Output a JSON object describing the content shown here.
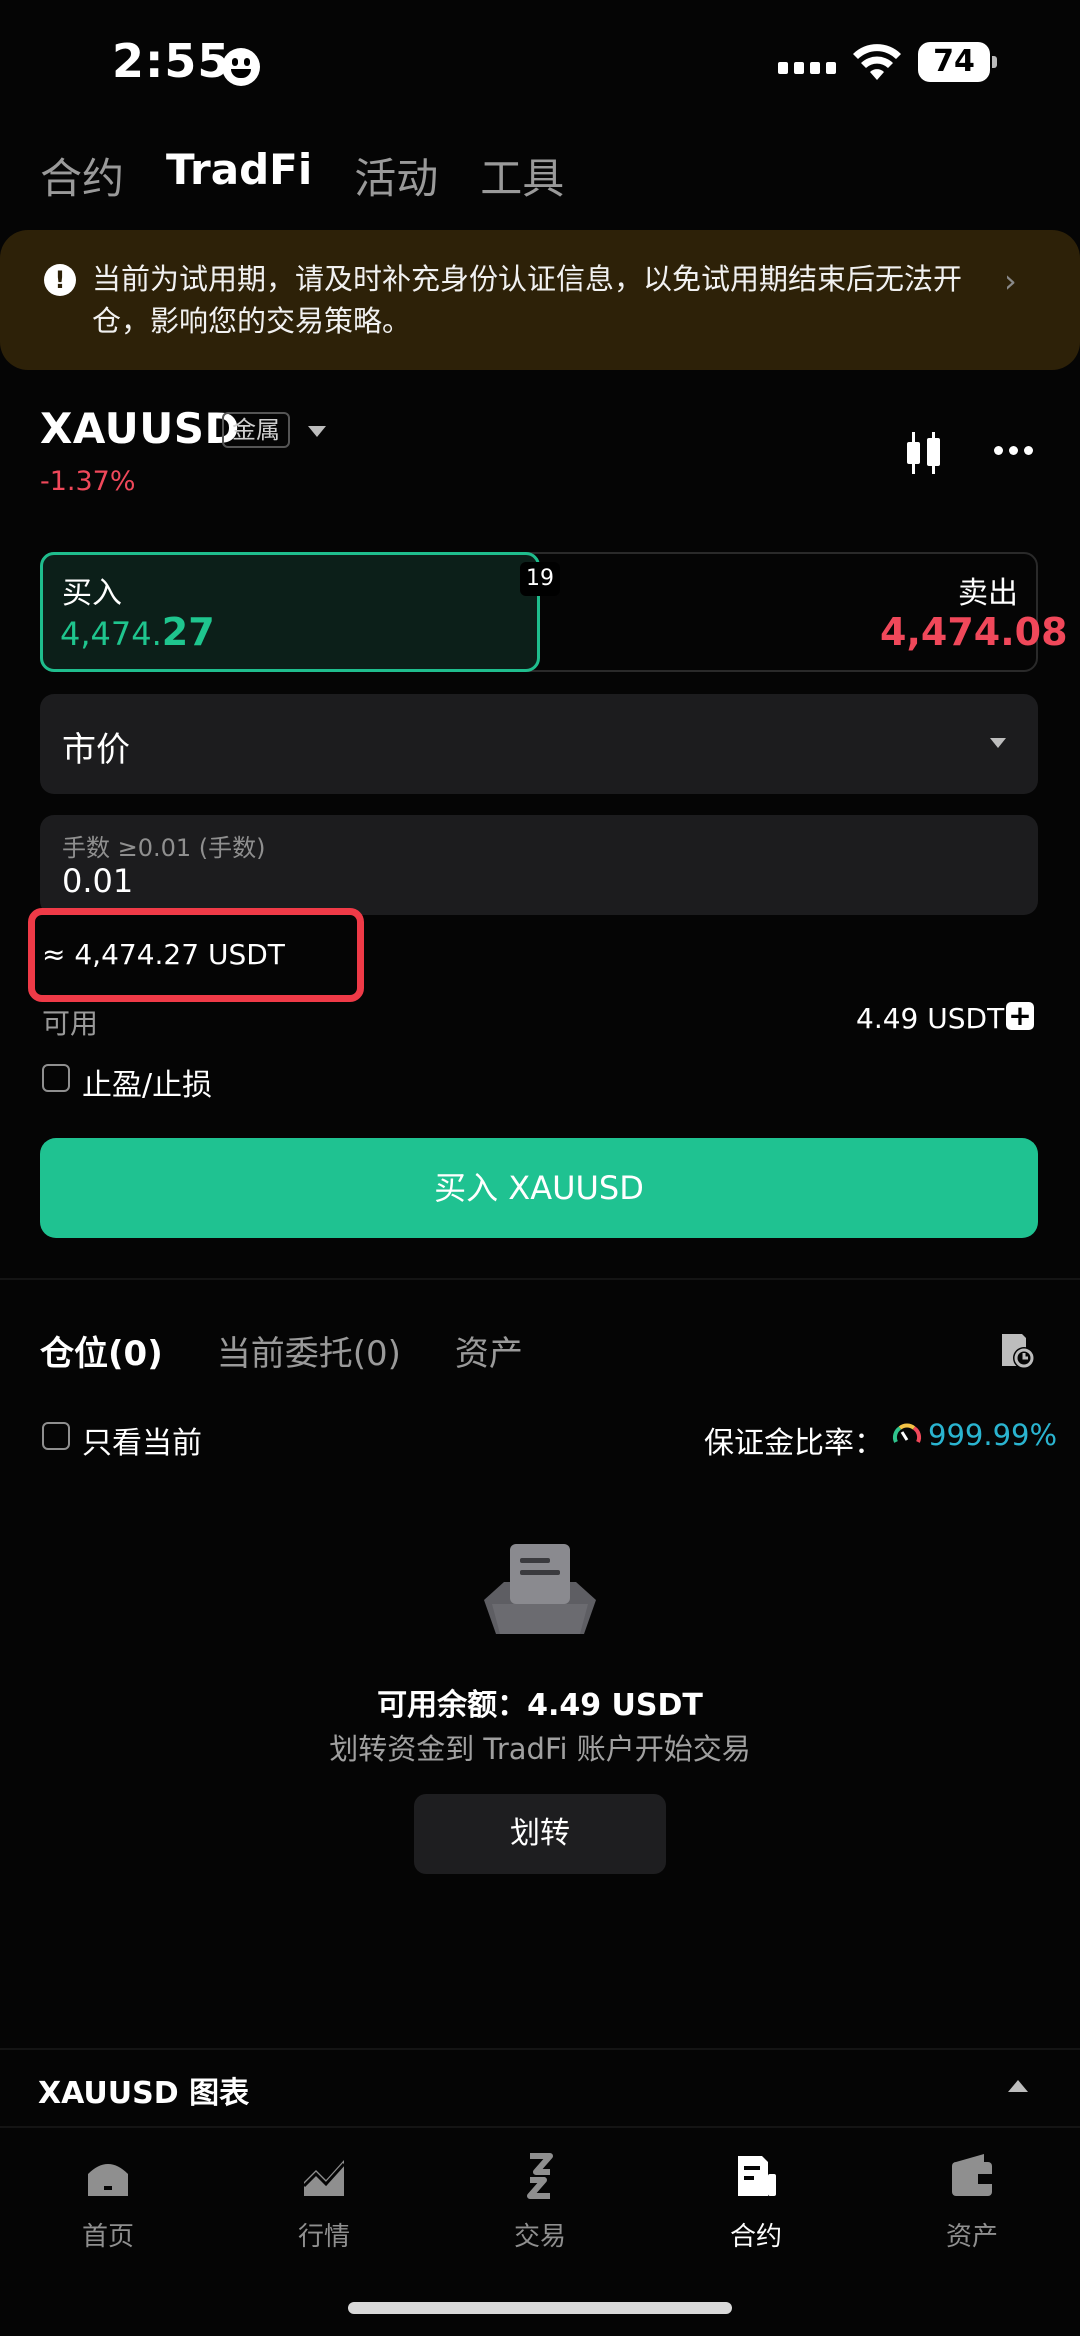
{
  "status_bar": {
    "time": "2:55",
    "battery": "74"
  },
  "top_tabs": [
    "合约",
    "TradFi",
    "活动",
    "工具"
  ],
  "banner": {
    "text": "当前为试用期，请及时补充身份认证信息，以免试用期结束后无法开仓，影响您的交易策略。"
  },
  "instrument": {
    "symbol": "XAUUSD",
    "category": "金属",
    "change": "-1.37%"
  },
  "quote": {
    "buy_label": "买入",
    "buy_price_main": "4,474.",
    "buy_price_tail": "27",
    "spread": "19",
    "sell_label": "卖出",
    "sell_price": "4,474.08"
  },
  "order_form": {
    "order_type": "市价",
    "qty_placeholder": "手数 ≥0.01 (手数)",
    "qty_value": "0.01",
    "approx_value": "≈ 4,474.27 USDT",
    "available_label": "可用",
    "available_value": "4.49 USDT",
    "tp_sl_label": "止盈/止损",
    "buy_button": "买入 XAUUSD"
  },
  "positions": {
    "tabs": [
      "仓位(0)",
      "当前委托(0)",
      "资产"
    ],
    "only_current_label": "只看当前",
    "margin_ratio_label": "保证金比率：",
    "margin_ratio_value": "999.99%"
  },
  "empty_state": {
    "balance": "可用余额：4.49 USDT",
    "hint": "划转资金到 TradFi 账户开始交易",
    "transfer_button": "划转"
  },
  "chart_bar": {
    "title": "XAUUSD  图表"
  },
  "bottom_nav": [
    {
      "label": "首页",
      "icon": "home-icon"
    },
    {
      "label": "行情",
      "icon": "market-icon"
    },
    {
      "label": "交易",
      "icon": "trade-icon"
    },
    {
      "label": "合约",
      "icon": "futures-icon",
      "active": true
    },
    {
      "label": "资产",
      "icon": "wallet-icon"
    }
  ],
  "colors": {
    "green": "#1fc291",
    "red": "#f0485a",
    "highlight_border": "#ef3a47",
    "accent_blue": "#2ab4d0"
  }
}
